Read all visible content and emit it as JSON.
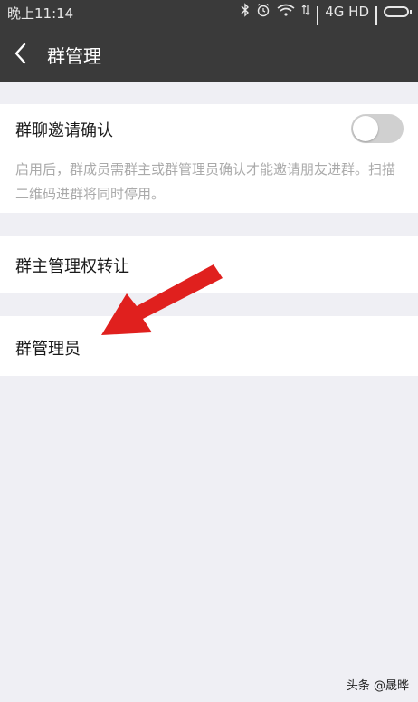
{
  "status_bar": {
    "time": "晚上11:14",
    "network": "4G HD"
  },
  "header": {
    "title": "群管理",
    "back_icon": "chevron-left-icon"
  },
  "group_invite_confirm": {
    "label": "群聊邀请确认",
    "enabled": false,
    "description": "启用后，群成员需群主或群管理员确认才能邀请朋友进群。扫描二维码进群将同时停用。"
  },
  "transfer_owner": {
    "label": "群主管理权转让"
  },
  "group_admins": {
    "label": "群管理员"
  },
  "annotation_arrow_color": "#e0201e",
  "watermark": "头条 @晟晔"
}
